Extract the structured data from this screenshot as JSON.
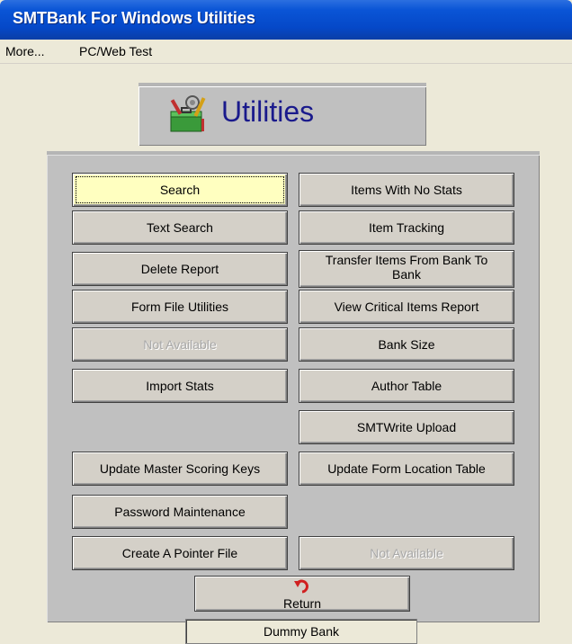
{
  "window": {
    "title": "SMTBank For Windows Utilities"
  },
  "menu": {
    "items": [
      "More...",
      "PC/Web Test"
    ]
  },
  "header": {
    "title": "Utilities",
    "icon": "toolbox-icon"
  },
  "buttons": {
    "search": "Search",
    "text_search": "Text Search",
    "delete_report": "Delete Report",
    "form_file_utilities": "Form File Utilities",
    "not_available_left": "Not Available",
    "import_stats": "Import Stats",
    "update_master_scoring_keys": "Update Master Scoring Keys",
    "password_maintenance": "Password Maintenance",
    "create_pointer_file": "Create A Pointer File",
    "items_no_stats": "Items With No Stats",
    "item_tracking": "Item Tracking",
    "transfer_items_line1": "Transfer Items From Bank To",
    "transfer_items_line2": "Bank",
    "view_critical_items": "View Critical Items Report",
    "bank_size": "Bank Size",
    "author_table": "Author Table",
    "smtwrite_upload": "SMTWrite Upload",
    "update_form_location": "Update Form Location Table",
    "not_available_right": "Not Available",
    "return": "Return"
  },
  "status": {
    "bank": "Dummy Bank"
  }
}
